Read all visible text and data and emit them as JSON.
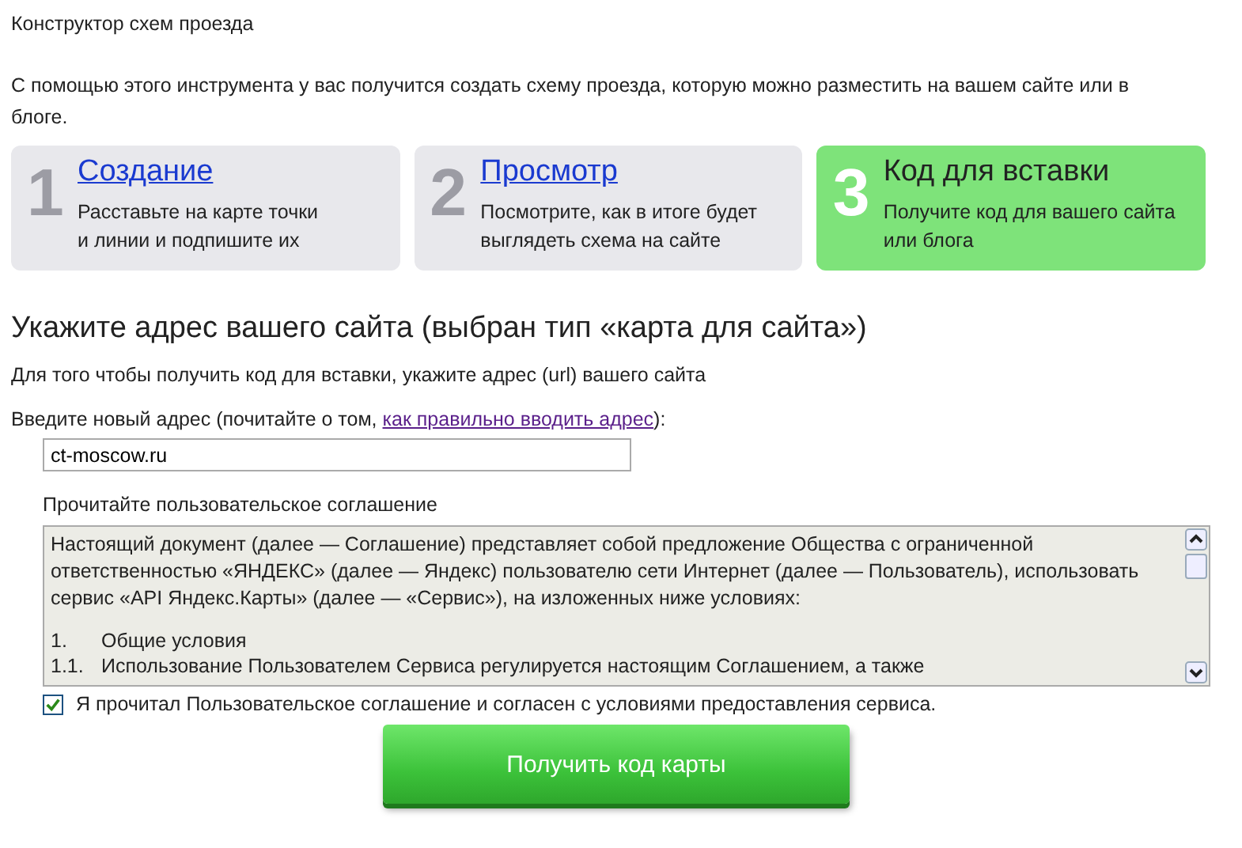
{
  "page_title": "Конструктор схем проезда",
  "intro": "С помощью этого инструмента у вас получится создать схему проезда, которую можно разместить на вашем сайте или в блоге.",
  "steps": [
    {
      "number": "1",
      "title": "Создание",
      "description": [
        "Расставьте на карте точки",
        "и линии и подпишите их"
      ],
      "selected": false
    },
    {
      "number": "2",
      "title": "Просмотр",
      "description": [
        "Посмотрите, как в итоге будет",
        "выглядеть схема на сайте"
      ],
      "selected": false
    },
    {
      "number": "3",
      "title": "Код для вставки",
      "description": [
        "Получите код для вашего сайта",
        "или блога"
      ],
      "selected": true
    }
  ],
  "heading": "Укажите адрес вашего сайта (выбран тип «карта для сайта»)",
  "hint": "Для того чтобы получить код для вставки, укажите адрес (url) вашего сайта",
  "address_label": {
    "before": "Введите новый адрес (почитайте о том,",
    "link": "как правильно вводить адрес",
    "after": "):"
  },
  "address_field": {
    "value": "ct-moscow.ru"
  },
  "agreement": {
    "label": "Прочитайте пользовательское соглашение",
    "paragraphs": [
      "Настоящий документ (далее — Соглашение) представляет собой предложение Общества с ограниченной ответственностью «ЯНДЕКС» (далее — Яндекс) пользователю сети Интернет (далее — Пользователь), использовать сервис «API Яндекс.Карты» (далее — «Сервис»), на изложенных ниже условиях:"
    ],
    "items": [
      {
        "number": "1.",
        "text": "Общие условия"
      },
      {
        "number": "1.1.",
        "text": "Использование Пользователем Сервиса регулируется настоящим Соглашением, а также"
      }
    ]
  },
  "consent": {
    "label": "Я прочитал Пользовательское соглашение и согласен с условиями предоставления сервиса.",
    "checked": true
  },
  "submit_button": "Получить код карты"
}
